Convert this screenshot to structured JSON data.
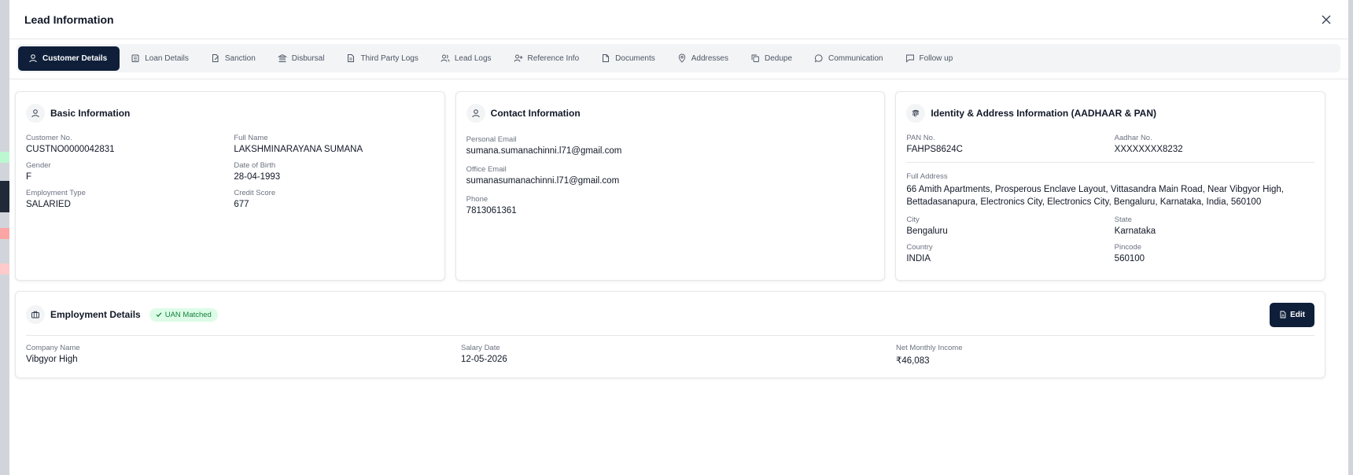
{
  "modal": {
    "title": "Lead Information"
  },
  "tabs": [
    {
      "label": "Customer Details",
      "icon": "user-icon",
      "active": true
    },
    {
      "label": "Loan Details",
      "icon": "bank-icon",
      "active": false
    },
    {
      "label": "Sanction",
      "icon": "edit-doc-icon",
      "active": false
    },
    {
      "label": "Disbursal",
      "icon": "landmark-icon",
      "active": false
    },
    {
      "label": "Third Party Logs",
      "icon": "file-text-icon",
      "active": false
    },
    {
      "label": "Lead Logs",
      "icon": "users-icon",
      "active": false
    },
    {
      "label": "Reference Info",
      "icon": "user-plus-icon",
      "active": false
    },
    {
      "label": "Documents",
      "icon": "file-icon",
      "active": false
    },
    {
      "label": "Addresses",
      "icon": "map-pin-icon",
      "active": false
    },
    {
      "label": "Dedupe",
      "icon": "copy-icon",
      "active": false
    },
    {
      "label": "Communication",
      "icon": "message-circle-icon",
      "active": false
    },
    {
      "label": "Follow up",
      "icon": "message-square-icon",
      "active": false
    }
  ],
  "basic": {
    "title": "Basic Information",
    "customer_no_label": "Customer No.",
    "customer_no": "CUSTNO0000042831",
    "full_name_label": "Full Name",
    "full_name": "LAKSHMINARAYANA SUMANA",
    "gender_label": "Gender",
    "gender": "F",
    "dob_label": "Date of Birth",
    "dob": "28-04-1993",
    "employment_type_label": "Employment Type",
    "employment_type": "SALARIED",
    "credit_score_label": "Credit Score",
    "credit_score": "677"
  },
  "contact": {
    "title": "Contact Information",
    "personal_email_label": "Personal Email",
    "personal_email": "sumana.sumanachinni.l71@gmail.com",
    "office_email_label": "Office Email",
    "office_email": "sumanasumanachinni.l71@gmail.com",
    "phone_label": "Phone",
    "phone": "7813061361"
  },
  "identity": {
    "title": "Identity & Address Information (AADHAAR & PAN)",
    "pan_label": "PAN No.",
    "pan": "FAHPS8624C",
    "aadhar_label": "Aadhar No.",
    "aadhar": "XXXXXXXX8232",
    "full_address_label": "Full Address",
    "full_address": "66 Amith Apartments, Prosperous Enclave Layout, Vittasandra Main Road, Near Vibgyor High, Bettadasanapura, Electronics City, Electronics City, Bengaluru, Karnataka, India, 560100",
    "city_label": "City",
    "city": "Bengaluru",
    "state_label": "State",
    "state": "Karnataka",
    "country_label": "Country",
    "country": "INDIA",
    "pincode_label": "Pincode",
    "pincode": "560100"
  },
  "employment": {
    "title": "Employment Details",
    "badge": "UAN Matched",
    "edit_label": "Edit",
    "company_label": "Company Name",
    "company": "Vibgyor High",
    "salary_date_label": "Salary Date",
    "salary_date": "12-05-2026",
    "income_label": "Net Monthly Income",
    "income": "₹46,083"
  },
  "colors": {
    "primary": "#0f1f3a",
    "badge_bg": "#dcfce7",
    "badge_text": "#15803d"
  }
}
